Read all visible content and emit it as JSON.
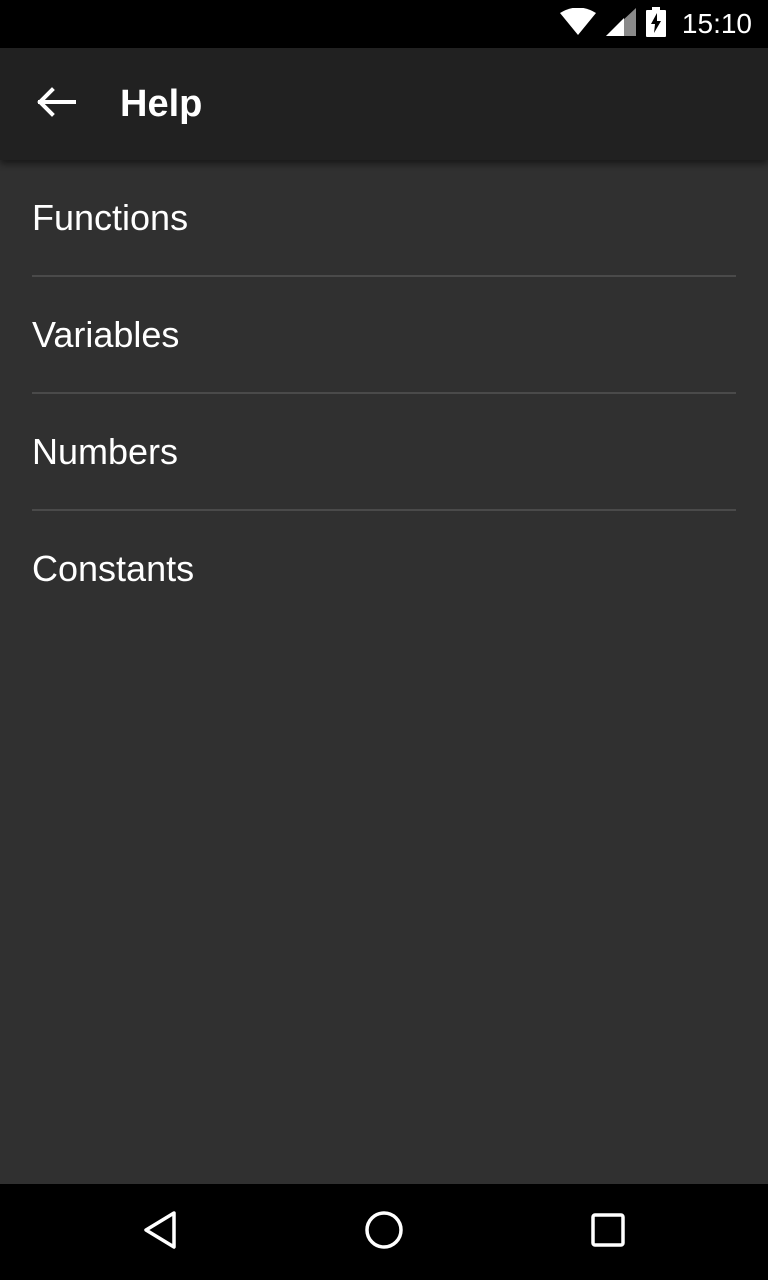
{
  "status_bar": {
    "time": "15:10",
    "icons": [
      "wifi-icon",
      "cell-signal-icon",
      "battery-charging-icon"
    ]
  },
  "app_bar": {
    "title": "Help",
    "back_icon": "arrow-left-icon"
  },
  "help_list": {
    "items": [
      {
        "label": "Functions"
      },
      {
        "label": "Variables"
      },
      {
        "label": "Numbers"
      },
      {
        "label": "Constants"
      }
    ]
  },
  "nav_bar": {
    "icons": [
      "back-triangle-icon",
      "home-circle-icon",
      "recents-square-icon"
    ]
  },
  "colors": {
    "status_bar": "#000000",
    "app_bar": "#212121",
    "background": "#303030",
    "divider": "#4a4a4a",
    "text": "#ffffff"
  }
}
